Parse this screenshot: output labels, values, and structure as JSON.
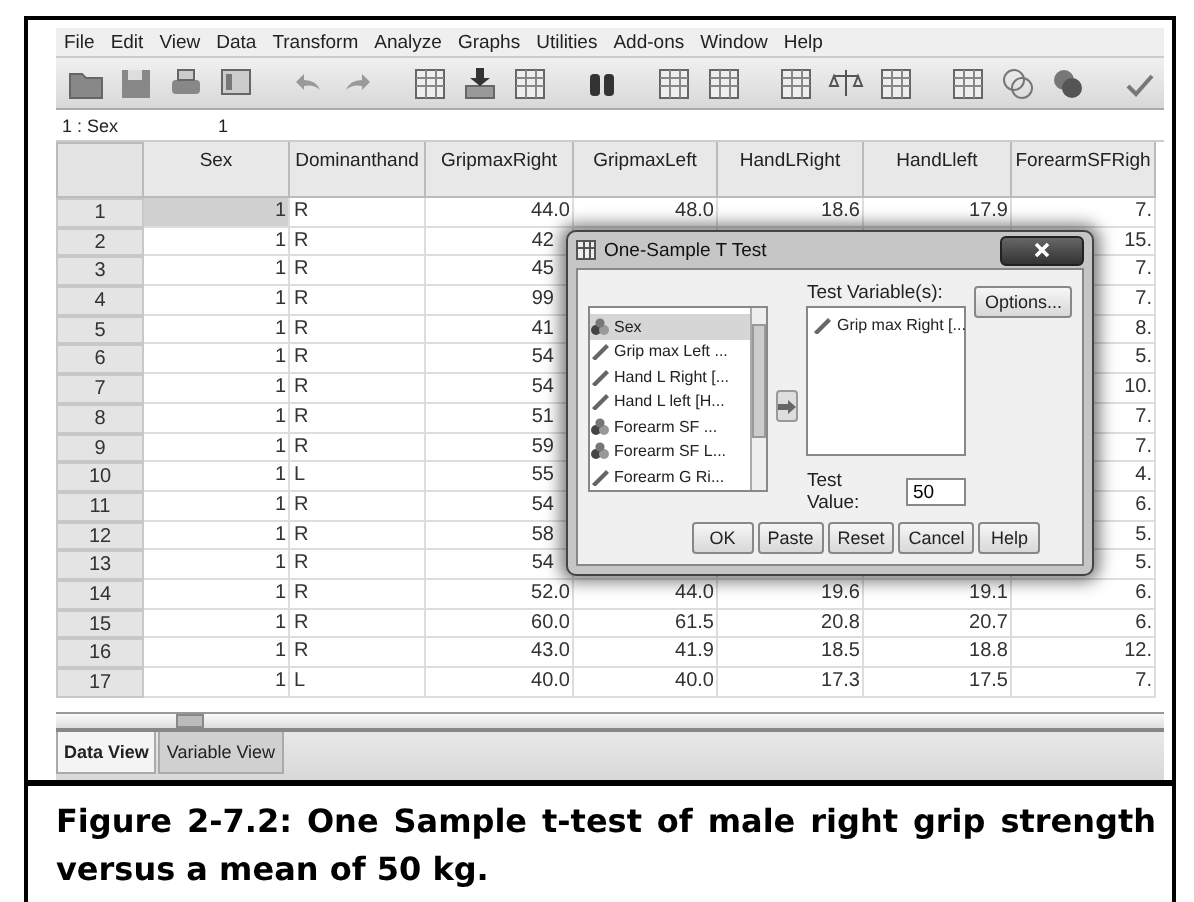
{
  "menu": [
    "File",
    "Edit",
    "View",
    "Data",
    "Transform",
    "Analyze",
    "Graphs",
    "Utilities",
    "Add-ons",
    "Window",
    "Help"
  ],
  "cell_editor": {
    "ref": "1 : Sex",
    "value": "1"
  },
  "table": {
    "columns": [
      "Sex",
      "Dominanthand",
      "GripmaxRight",
      "GripmaxLeft",
      "HandLRight",
      "HandLleft",
      "ForearmSFRigh"
    ],
    "rows": [
      {
        "num": "1",
        "active": true,
        "covered": false,
        "cells": [
          "1",
          "R",
          "44.0",
          "48.0",
          "18.6",
          "17.9",
          "7."
        ]
      },
      {
        "num": "2",
        "active": false,
        "covered": true,
        "cells": [
          "1",
          "R",
          "42",
          null,
          null,
          null,
          "15."
        ]
      },
      {
        "num": "3",
        "active": false,
        "covered": true,
        "cells": [
          "1",
          "R",
          "45",
          null,
          null,
          null,
          "7."
        ]
      },
      {
        "num": "4",
        "active": false,
        "covered": true,
        "cells": [
          "1",
          "R",
          "99",
          null,
          null,
          null,
          "7."
        ]
      },
      {
        "num": "5",
        "active": false,
        "covered": true,
        "cells": [
          "1",
          "R",
          "41",
          null,
          null,
          null,
          "8."
        ]
      },
      {
        "num": "6",
        "active": false,
        "covered": true,
        "cells": [
          "1",
          "R",
          "54",
          null,
          null,
          null,
          "5."
        ]
      },
      {
        "num": "7",
        "active": false,
        "covered": true,
        "cells": [
          "1",
          "R",
          "54",
          null,
          null,
          null,
          "10."
        ]
      },
      {
        "num": "8",
        "active": false,
        "covered": true,
        "cells": [
          "1",
          "R",
          "51",
          null,
          null,
          null,
          "7."
        ]
      },
      {
        "num": "9",
        "active": false,
        "covered": true,
        "cells": [
          "1",
          "R",
          "59",
          null,
          null,
          null,
          "7."
        ]
      },
      {
        "num": "10",
        "active": false,
        "covered": true,
        "cells": [
          "1",
          "L",
          "55",
          null,
          null,
          null,
          "4."
        ]
      },
      {
        "num": "11",
        "active": false,
        "covered": true,
        "cells": [
          "1",
          "R",
          "54",
          null,
          null,
          null,
          "6."
        ]
      },
      {
        "num": "12",
        "active": false,
        "covered": true,
        "cells": [
          "1",
          "R",
          "58",
          null,
          null,
          null,
          "5."
        ]
      },
      {
        "num": "13",
        "active": false,
        "covered": true,
        "cells": [
          "1",
          "R",
          "54",
          null,
          null,
          null,
          "5."
        ]
      },
      {
        "num": "14",
        "active": false,
        "covered": false,
        "cells": [
          "1",
          "R",
          "52.0",
          "44.0",
          "19.6",
          "19.1",
          "6."
        ]
      },
      {
        "num": "15",
        "active": false,
        "covered": false,
        "cells": [
          "1",
          "R",
          "60.0",
          "61.5",
          "20.8",
          "20.7",
          "6."
        ]
      },
      {
        "num": "16",
        "active": false,
        "covered": false,
        "cells": [
          "1",
          "R",
          "43.0",
          "41.9",
          "18.5",
          "18.8",
          "12."
        ]
      },
      {
        "num": "17",
        "active": false,
        "covered": false,
        "cells": [
          "1",
          "L",
          "40.0",
          "40.0",
          "17.3",
          "17.5",
          "7."
        ]
      }
    ]
  },
  "dialog": {
    "title": "One-Sample T Test",
    "source_items": [
      {
        "label": "Sex",
        "kind": "nominal",
        "selected": true
      },
      {
        "label": "Grip max Left ...",
        "kind": "scale",
        "selected": false
      },
      {
        "label": "Hand L Right [...",
        "kind": "scale",
        "selected": false
      },
      {
        "label": "Hand L left [H...",
        "kind": "scale",
        "selected": false
      },
      {
        "label": "Forearm SF ...",
        "kind": "nominal",
        "selected": false
      },
      {
        "label": "Forearm SF L...",
        "kind": "nominal",
        "selected": false
      },
      {
        "label": "Forearm G Ri...",
        "kind": "scale",
        "selected": false
      }
    ],
    "target_label": "Test Variable(s):",
    "target_items": [
      {
        "label": "Grip max Right [...",
        "kind": "scale"
      }
    ],
    "options_button": "Options...",
    "test_value_label": "Test Value:",
    "test_value": "50",
    "buttons": [
      "OK",
      "Paste",
      "Reset",
      "Cancel",
      "Help"
    ]
  },
  "tabs": [
    {
      "label": "Data View",
      "selected": true
    },
    {
      "label": "Variable View",
      "selected": false
    }
  ],
  "caption": "Figure 2-7.2: One Sample t-test of male right grip strength versus a mean of 50 kg."
}
